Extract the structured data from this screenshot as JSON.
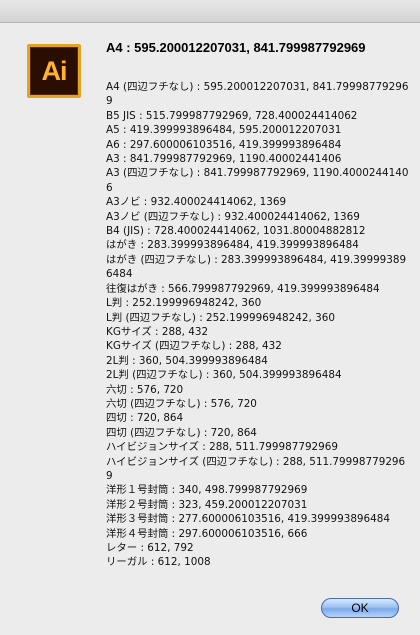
{
  "dialog": {
    "icon_text": "Ai",
    "heading": "A4 : 595.200012207031, 841.799987792969",
    "lines": [
      "A4 (四辺フチなし) : 595.200012207031, 841.799987792969",
      "B5 JIS : 515.799987792969, 728.400024414062",
      "A5 : 419.399993896484, 595.200012207031",
      "A6 : 297.600006103516, 419.399993896484",
      "A3 : 841.799987792969, 1190.40002441406",
      "A3 (四辺フチなし) : 841.799987792969, 1190.40002441406",
      "A3ノビ : 932.400024414062, 1369",
      "A3ノビ (四辺フチなし) : 932.400024414062, 1369",
      "B4 (JIS) : 728.400024414062, 1031.80004882812",
      "はがき : 283.399993896484, 419.399993896484",
      "はがき (四辺フチなし) : 283.399993896484, 419.399993896484",
      "往復はがき : 566.799987792969, 419.399993896484",
      "L判 : 252.199996948242, 360",
      "L判 (四辺フチなし) : 252.199996948242, 360",
      "KGサイズ : 288, 432",
      "KGサイズ (四辺フチなし) : 288, 432",
      "2L判 : 360, 504.399993896484",
      "2L判 (四辺フチなし) : 360, 504.399993896484",
      "六切 : 576, 720",
      "六切 (四辺フチなし) : 576, 720",
      "四切 : 720, 864",
      "四切 (四辺フチなし) : 720, 864",
      "ハイビジョンサイズ : 288, 511.799987792969",
      "ハイビジョンサイズ (四辺フチなし) : 288, 511.799987792969",
      "洋形１号封筒 : 340, 498.799987792969",
      "洋形２号封筒 : 323, 459.200012207031",
      "洋形３号封筒 : 277.600006103516, 419.399993896484",
      "洋形４号封筒 : 297.600006103516, 666",
      "レター : 612, 792",
      "リーガル : 612, 1008"
    ],
    "ok_label": "OK"
  }
}
